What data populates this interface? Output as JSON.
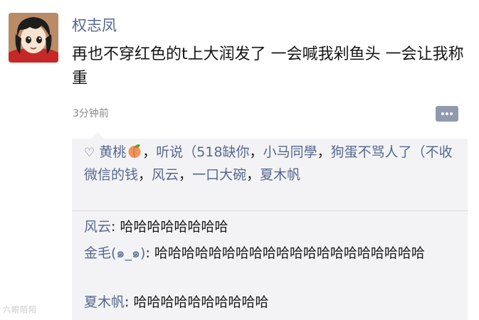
{
  "post": {
    "author": "权志凤",
    "text": "再也不穿红色的t上大润发了 一会喊我剁鱼头 一会让我称重",
    "time": "3分钟前"
  },
  "likes": {
    "icon": "heart-outline-icon",
    "names": [
      "黄桃",
      "听说（518缺你",
      "小马同學",
      "狗蛋不骂人了（不收微信的钱",
      "风云",
      "一口大碗",
      "夏木帆"
    ]
  },
  "comments": [
    {
      "author": "风云",
      "text": "哈哈哈哈哈哈哈哈"
    },
    {
      "author": "金毛(๑_๑)",
      "text": "哈哈哈哈哈哈哈哈哈哈哈哈哈哈哈哈哈哈哈哈"
    },
    {
      "author": "夏木帆",
      "text": "哈哈哈哈哈哈哈哈哈哈"
    }
  ],
  "watermark": "六眼陌陌",
  "colors": {
    "link": "#56688f",
    "panel": "#f3f3f5",
    "more_button": "#8f9aae"
  }
}
